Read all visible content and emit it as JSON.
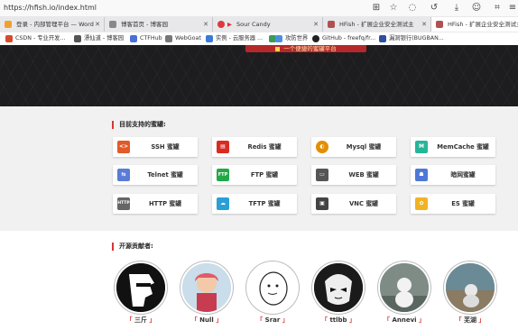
{
  "browser": {
    "url": "https://hfish.io/index.html",
    "toolbar_icons": [
      "grid-icon",
      "star-icon",
      "sync-icon",
      "history-back-icon",
      "download-icon",
      "profile-icon",
      "crop-icon",
      "menu-icon"
    ],
    "tabs": [
      {
        "label": "登录 - 内部管理平台 — Word",
        "favicon_color": "#f0a030"
      },
      {
        "label": "博客首页 - 博客园",
        "favicon_color": "#888888"
      },
      {
        "label": "Sour Candy",
        "favicon_color": "#e0383e",
        "extra": "▶"
      },
      {
        "label": "HFish - 扩展企业安全测试主",
        "favicon_color": "#b05050"
      },
      {
        "label": "HFish - 扩展企业安全测试主",
        "favicon_color": "#b05050"
      }
    ],
    "bookmarks": [
      {
        "label": "CSDN - 专业开发...",
        "color": "#d84a2b"
      },
      {
        "label": "漂仙道 - 博客园",
        "color": "#555555"
      },
      {
        "label": "CTFHub",
        "color": "#4a6fd8"
      },
      {
        "label": "WebGoat",
        "color": "#777777"
      },
      {
        "label": "实例 - 云服务器 ...",
        "color": "#3a7bd5"
      },
      {
        "label": "",
        "color": "#3a9b5a"
      },
      {
        "label": "攻防世界",
        "color": "#4a90e2"
      },
      {
        "label": "GitHub - freefq/fr...",
        "color": "#222222"
      },
      {
        "label": "漏洞银行(BUGBAN...",
        "color": "#2d4f9e"
      }
    ]
  },
  "page": {
    "slogan": "一个便捷的蜜罐平台",
    "honeypots_title": "目前支持的蜜罐:",
    "honeypots": [
      {
        "label": "SSH 蜜罐",
        "icon": "ssh-icon",
        "color": "#e25a28",
        "glyph": "<>"
      },
      {
        "label": "Redis 蜜罐",
        "icon": "redis-icon",
        "color": "#d82c20",
        "glyph": "▤"
      },
      {
        "label": "Mysql 蜜罐",
        "icon": "mysql-icon",
        "color": "#e48e00",
        "glyph": "◐"
      },
      {
        "label": "MemCache 蜜罐",
        "icon": "memcache-icon",
        "color": "#26b59a",
        "glyph": "M"
      },
      {
        "label": "Telnet 蜜罐",
        "icon": "telnet-icon",
        "color": "#5b7bd5",
        "glyph": "⇆"
      },
      {
        "label": "FTP 蜜罐",
        "icon": "ftp-icon",
        "color": "#23a848",
        "glyph": "FTP"
      },
      {
        "label": "WEB 蜜罐",
        "icon": "web-icon",
        "color": "#555555",
        "glyph": "▭"
      },
      {
        "label": "暗网蜜罐",
        "icon": "darknet-icon",
        "color": "#4f78d6",
        "glyph": "☗"
      },
      {
        "label": "HTTP 蜜罐",
        "icon": "http-icon",
        "color": "#666666",
        "glyph": "HTTP"
      },
      {
        "label": "TFTP 蜜罐",
        "icon": "tftp-icon",
        "color": "#2a9fd6",
        "glyph": "☁"
      },
      {
        "label": "VNC 蜜罐",
        "icon": "vnc-icon",
        "color": "#444444",
        "glyph": "▣"
      },
      {
        "label": "ES 蜜罐",
        "icon": "es-icon",
        "color": "#f0b323",
        "glyph": "✿"
      }
    ],
    "contributors_title": "开源贡献者:",
    "contributors": [
      {
        "name": "三斤",
        "avatar_bg": "#111111"
      },
      {
        "name": "Null",
        "avatar_bg": "#c9ddea"
      },
      {
        "name": "Srar",
        "avatar_bg": "#ffffff"
      },
      {
        "name": "ttlbb",
        "avatar_bg": "#1a1a1a"
      },
      {
        "name": "Annevi",
        "avatar_bg": "#9aa7a0"
      },
      {
        "name": "芜湖",
        "avatar_bg": "#6a8a96"
      }
    ]
  }
}
